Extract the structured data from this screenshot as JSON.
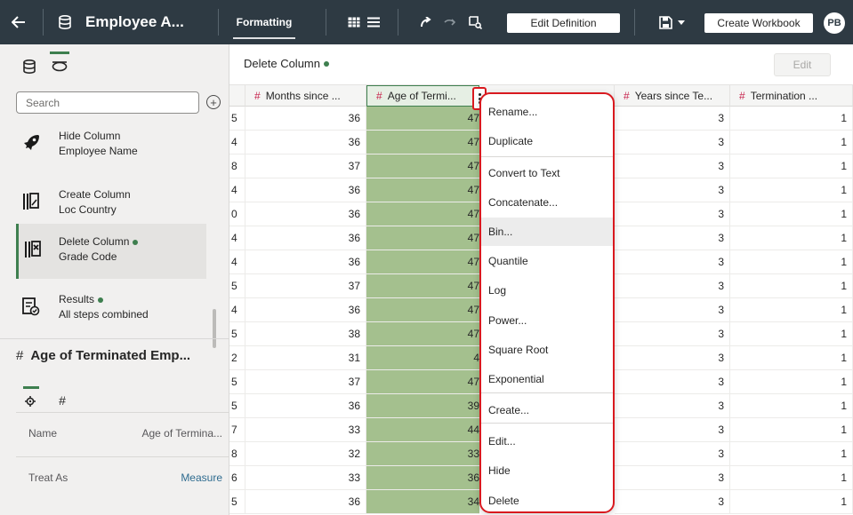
{
  "topbar": {
    "title": "Employee A...",
    "formatting": "Formatting",
    "edit_definition": "Edit Definition",
    "create_workbook": "Create Workbook",
    "avatar": "PB"
  },
  "left": {
    "search_placeholder": "Search",
    "steps": [
      {
        "title": "Hide Column",
        "sub": "Employee Name"
      },
      {
        "title": "Create Column",
        "sub": "Loc Country"
      },
      {
        "title": "Delete Column",
        "sub": "Grade Code"
      },
      {
        "title": "Results",
        "sub": "All steps combined"
      }
    ],
    "props_title": "Age of Terminated Emp...",
    "hash": "#",
    "props": [
      {
        "label": "Name",
        "value": "Age of Termina..."
      },
      {
        "label": "Treat As",
        "value": "Measure"
      }
    ]
  },
  "main": {
    "step_title": "Delete Column",
    "edit_label": "Edit"
  },
  "grid": {
    "headers": [
      "Months since ...",
      "Age of Termi...",
      "Years since Te...",
      "Termination ..."
    ],
    "col0_clip": [
      "5",
      "4",
      "8",
      "4",
      "0",
      "4",
      "4",
      "5",
      "4",
      "5",
      "2",
      "5",
      "5",
      "7",
      "8",
      "6",
      "5"
    ],
    "months": [
      "36",
      "36",
      "37",
      "36",
      "36",
      "36",
      "36",
      "37",
      "36",
      "38",
      "31",
      "37",
      "36",
      "33",
      "32",
      "33",
      "36"
    ],
    "age": [
      "47",
      "47",
      "47",
      "47",
      "47",
      "47",
      "47",
      "47",
      "47",
      "47",
      "4",
      "47",
      "39",
      "44",
      "33",
      "36",
      "34"
    ],
    "years": [
      "3",
      "3",
      "3",
      "3",
      "3",
      "3",
      "3",
      "3",
      "3",
      "3",
      "3",
      "3",
      "3",
      "3",
      "3",
      "3",
      "3"
    ],
    "termination": [
      "1",
      "1",
      "1",
      "1",
      "1",
      "1",
      "1",
      "1",
      "1",
      "1",
      "1",
      "1",
      "1",
      "1",
      "1",
      "1",
      "1"
    ]
  },
  "context_menu": {
    "items": [
      "Rename...",
      "Duplicate",
      "Convert to Text",
      "Concatenate...",
      "Bin...",
      "Quantile",
      "Log",
      "Power...",
      "Square Root",
      "Exponential",
      "Create...",
      "Edit...",
      "Hide",
      "Delete"
    ]
  },
  "colors": {
    "topbar": "#2e3a43",
    "accent_green": "#3e7f4f",
    "selected_column": "#a4c08e",
    "highlight_red": "#d9191f"
  }
}
